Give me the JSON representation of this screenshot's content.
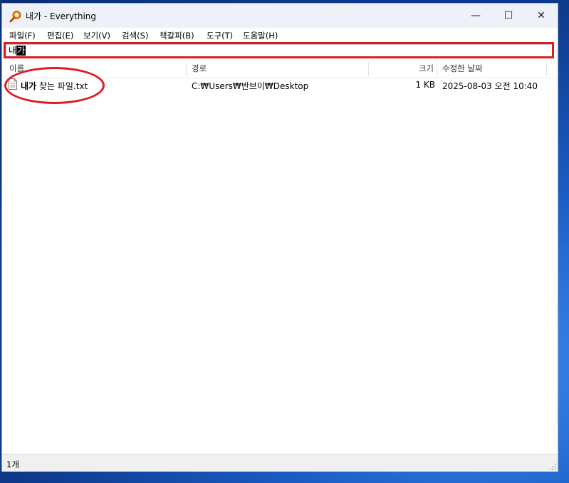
{
  "window": {
    "title": "내가 - Everything",
    "controls": {
      "minimize": "—",
      "maximize": "☐",
      "close": "✕"
    }
  },
  "menu": [
    "파일(F)",
    "편집(E)",
    "보기(V)",
    "검색(S)",
    "책갈피(B)",
    "도구(T)",
    "도움말(H)"
  ],
  "search": {
    "text_prefix": "내",
    "text_selected": "가"
  },
  "columns": {
    "name": "이름",
    "path": "경로",
    "size": "크기",
    "modified": "수정한 날짜"
  },
  "results": [
    {
      "name_match": "내가",
      "name_rest": " 찾는 파일.txt",
      "path": "C:₩Users₩반브이₩Desktop",
      "size": "1 KB",
      "modified": "2025-08-03 오전 10:40",
      "icon": "text-file-icon"
    }
  ],
  "status": {
    "count": "1개"
  },
  "colors": {
    "annotation": "#e01b24",
    "titlebar": "#eef2f8"
  }
}
